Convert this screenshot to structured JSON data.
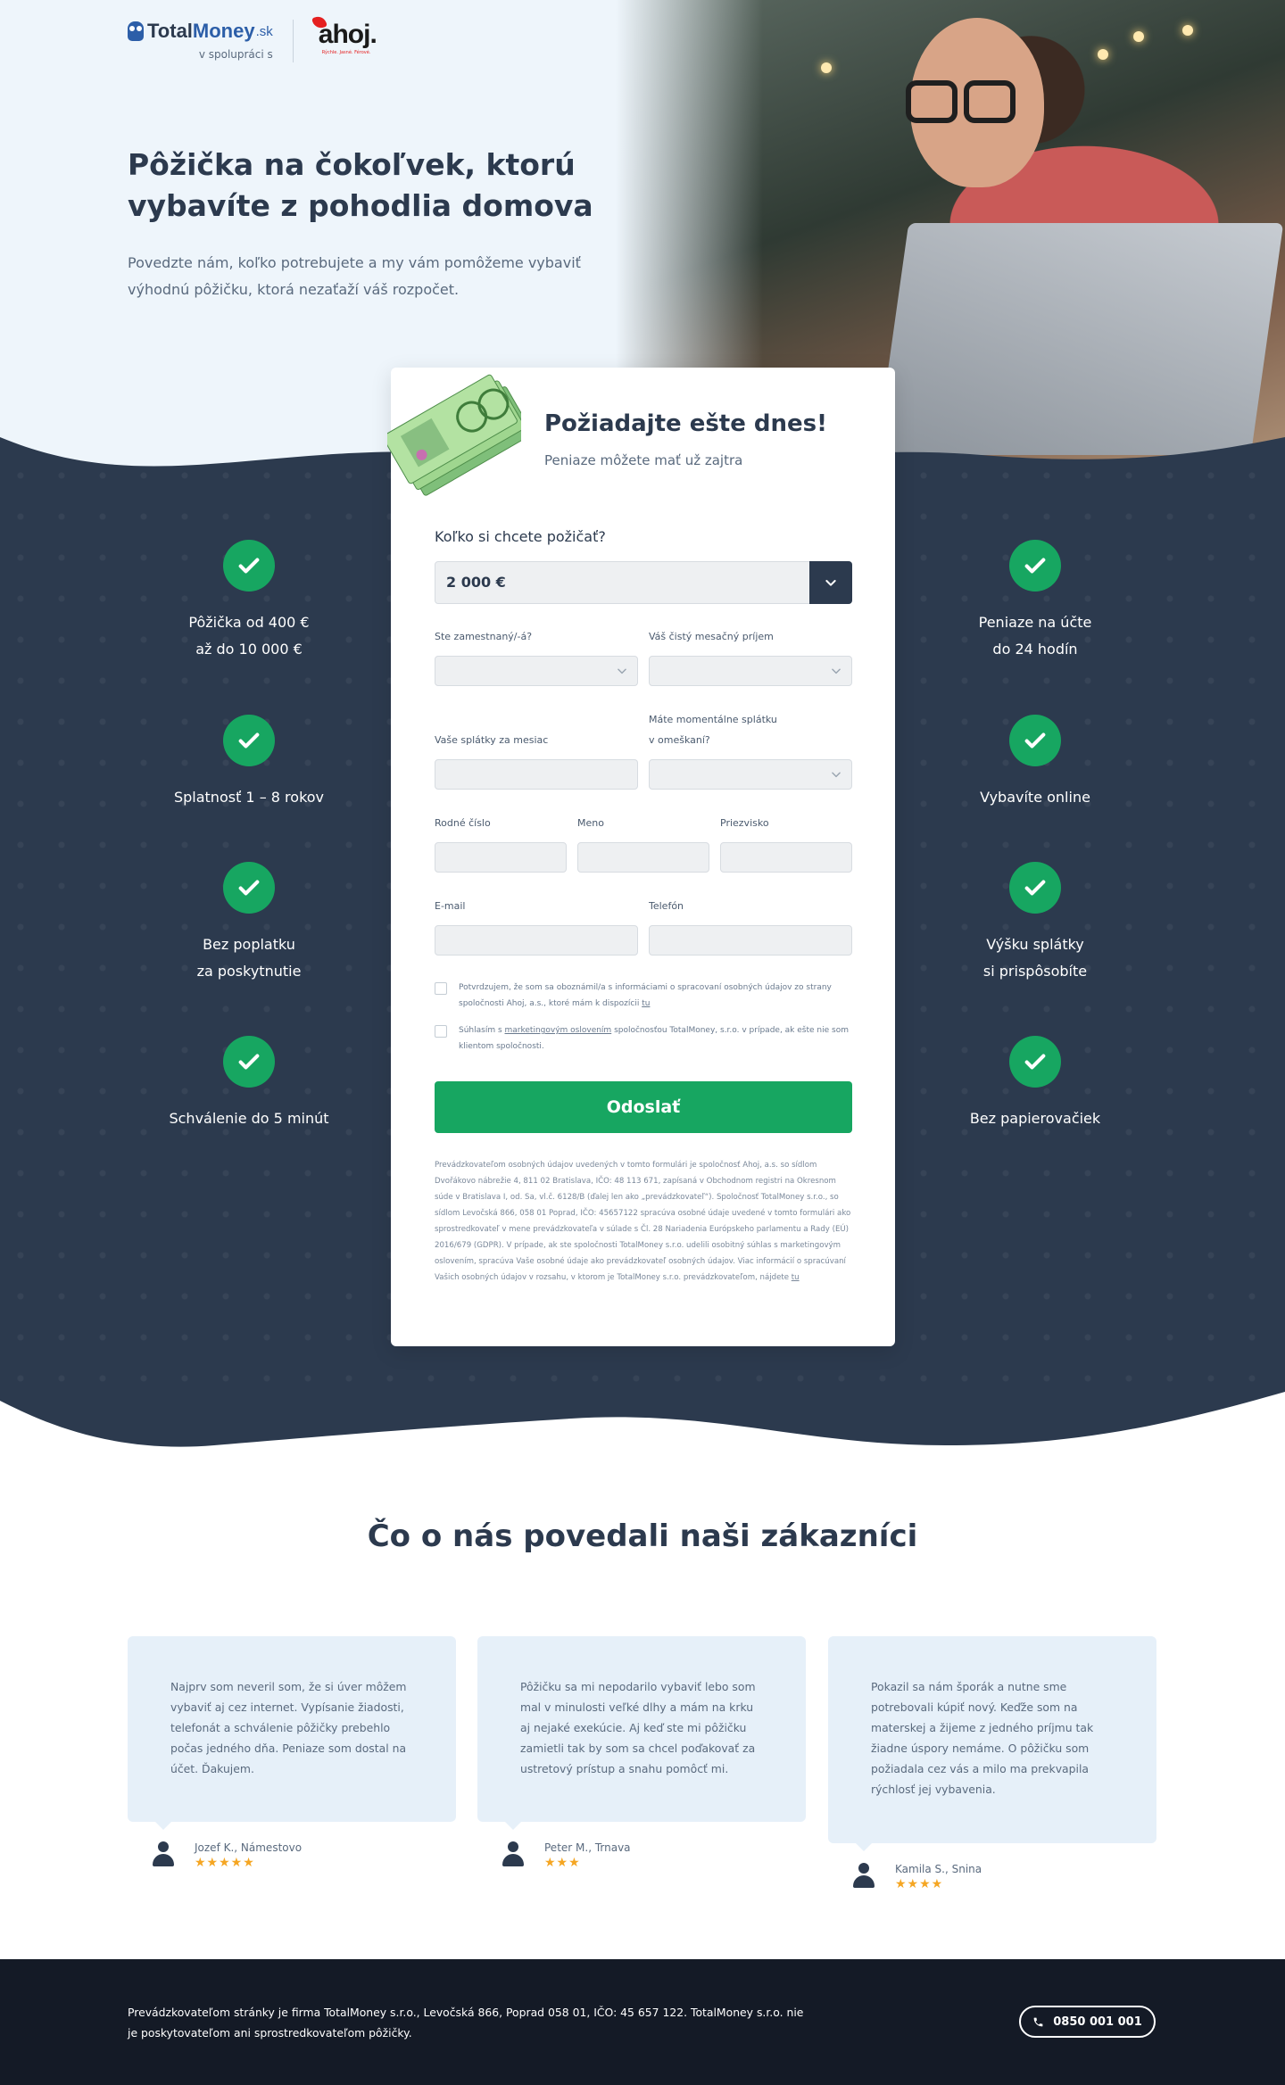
{
  "header": {
    "brand_name": "TotalMoney",
    "brand_name_part1": "Total",
    "brand_name_part2": "Money",
    "brand_tld": ".sk",
    "partner_prefix": "v spolupráci s",
    "partner_name": "ahoj.",
    "partner_tagline": "Rýchle. Jasné. Férové."
  },
  "hero": {
    "title": "Pôžička na čokoľvek, ktorú vybavíte z pohodlia domova",
    "text": "Povedzte nám, koľko potrebujete a my vám pomôžeme vybaviť výhodnú pôžičku, ktorá nezaťaží váš rozpočet."
  },
  "features_left": [
    {
      "text": "Pôžička od 400 €\naž do 10 000 €"
    },
    {
      "text": "Splatnosť 1 – 8 rokov"
    },
    {
      "text": "Bez poplatku\nza poskytnutie"
    },
    {
      "text": "Schválenie do 5 minút"
    }
  ],
  "features_right": [
    {
      "text": "Peniaze na účte\ndo 24 hodín"
    },
    {
      "text": "Vybavíte online"
    },
    {
      "text": "Výšku splátky\nsi prispôsobíte"
    },
    {
      "text": "Bez papierovačiek"
    }
  ],
  "form": {
    "title": "Požiadajte ešte dnes!",
    "subtitle": "Peniaze môžete mať už zajtra",
    "amount_label": "Koľko si chcete požičať?",
    "amount_value": "2 000 €",
    "employed_label": "Ste zamestnaný/-á?",
    "income_label": "Váš čistý mesačný príjem",
    "installments_label": "Vaše splátky za mesiac",
    "overdue_label_1": "Máte momentálne splátku",
    "overdue_label_2": "v omeškaní?",
    "birth_number_label": "Rodné číslo",
    "first_name_label": "Meno",
    "last_name_label": "Priezvisko",
    "email_label": "E-mail",
    "phone_label": "Telefón",
    "consent1_text": "Potvrdzujem, že som sa oboznámil/a s informáciami o spracovaní osobných údajov zo strany spoločnosti Ahoj, a.s., ktoré mám k dispozícii ",
    "consent1_link": "tu",
    "consent2_pre": "Súhlasím s ",
    "consent2_link": "marketingovým oslovením",
    "consent2_post": " spoločnosťou TotalMoney, s.r.o. v prípade, ak ešte nie som klientom spoločnosti.",
    "submit_label": "Odoslať",
    "fine_print": "Prevádzkovateľom osobných údajov uvedených v tomto formulári je spoločnosť Ahoj, a.s. so sídlom Dvořákovo nábrežie 4, 811 02 Bratislava, IČO: 48 113 671, zapísaná v Obchodnom registri na Okresnom súde v Bratislava I, od. Sa, vl.č. 6128/B (ďalej len ako „prevádzkovateľ“). Spoločnosť TotalMoney s.r.o., so sídlom Levočská 866, 058 01 Poprad, IČO: 45657122 spracúva osobné údaje uvedené v tomto formulári ako sprostredkovateľ v mene prevádzkovateľa v súlade s Čl. 28 Nariadenia Európskeho parlamentu a Rady (EÚ) 2016/679 (GDPR). V prípade, ak ste spoločnosti TotalMoney s.r.o. udelili osobitný súhlas s marketingovým oslovením, spracúva Vaše osobné údaje ako prevádzkovateľ osobných údajov. Viac informácií o spracúvaní Vašich osobných údajov v rozsahu, v ktorom je TotalMoney s.r.o. prevádzkovateľom, nájdete ",
    "fine_print_link": "tu"
  },
  "testimonials": {
    "title": "Čo o nás povedali naši zákazníci",
    "items": [
      {
        "text": "Najprv som neveril som, že si úver môžem vybaviť aj cez internet. Vypísanie žiadosti, telefonát a schválenie pôžičky prebehlo počas jedného dňa. Peniaze som dostal na účet. Ďakujem.",
        "author": "Jozef K., Námestovo",
        "stars": "★★★★★",
        "rating": 5
      },
      {
        "text": "Pôžičku sa mi nepodarilo vybaviť lebo som mal v minulosti veľké dlhy a mám na krku aj nejaké exekúcie. Aj keď ste mi pôžičku zamietli tak by som sa chcel poďakovať za ustretový prístup a snahu pomôcť mi.",
        "author": "Peter M., Trnava",
        "stars": "★★★",
        "rating": 3
      },
      {
        "text": "Pokazil sa nám šporák a nutne sme potrebovali kúpiť nový. Keďže som na materskej a žijeme z jedného príjmu tak žiadne úspory nemáme. O pôžičku som požiadala cez vás a milo ma prekvapila rýchlosť jej vybavenia.",
        "author": "Kamila S., Snina",
        "stars": "★★★★",
        "rating": 4
      }
    ]
  },
  "footer": {
    "text": "Prevádzkovateľom stránky je firma TotalMoney s.r.o., Levočská 866, Poprad 058 01, IČO: 45 657 122. TotalMoney s.r.o. nie je poskytovateľom ani sprostredkovateľom pôžičky.",
    "phone": "0850 001 001"
  },
  "colors": {
    "dark_navy": "#2c3a4e",
    "green": "#17a661",
    "light_blue": "#e6f0f9",
    "footer_bg": "#141a26",
    "star": "#f5a623",
    "ahoj_red": "#e52020"
  },
  "icons": [
    "owl-logo-icon",
    "check-icon",
    "chevron-down-icon",
    "money-bills-image",
    "user-icon",
    "star-icon",
    "phone-icon"
  ]
}
